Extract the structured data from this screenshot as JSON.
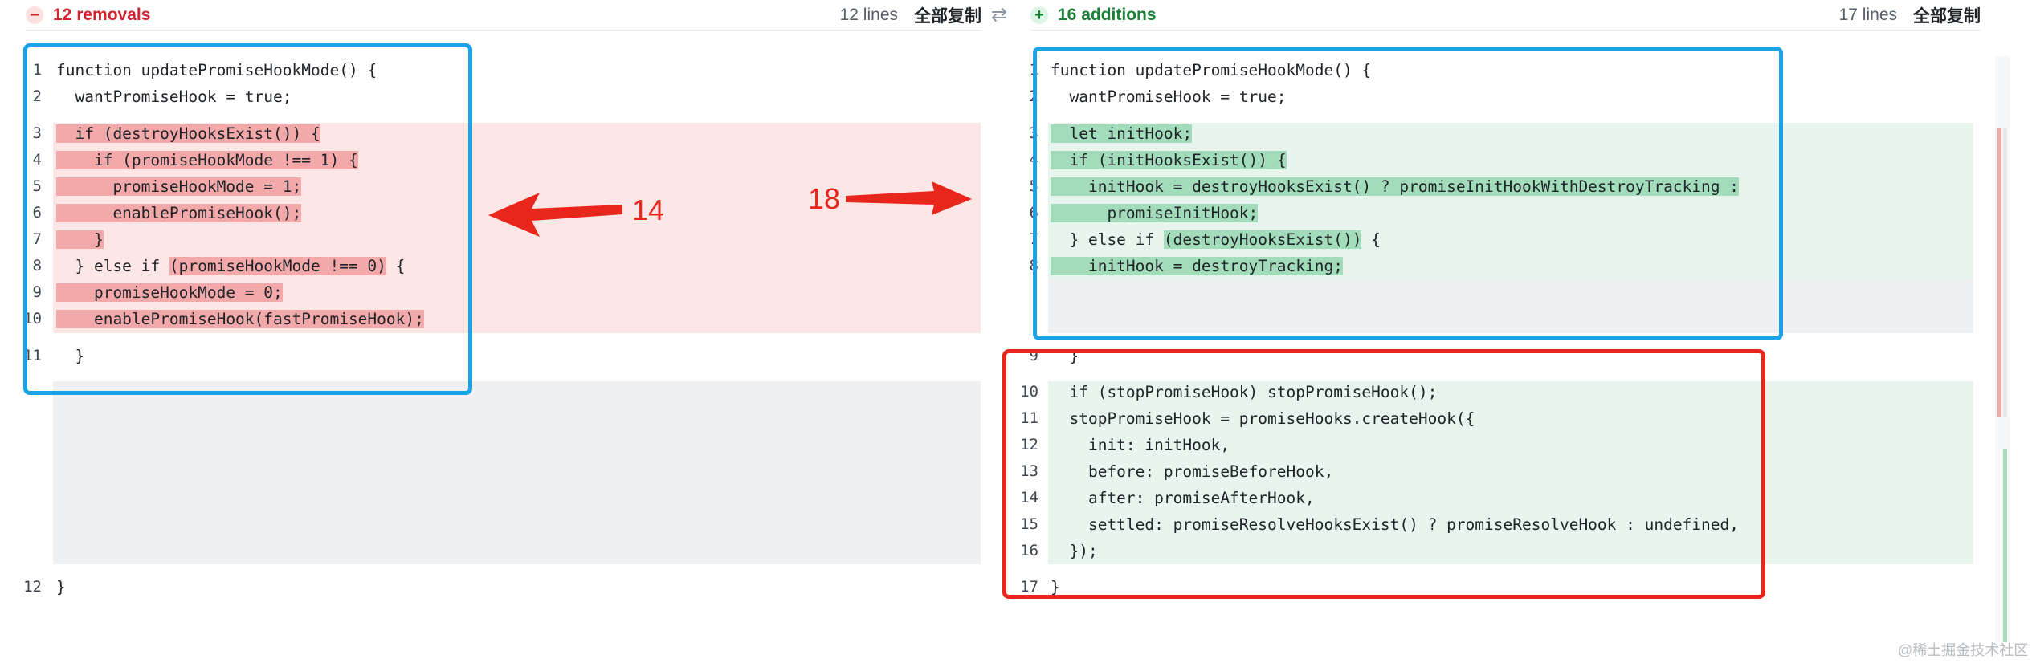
{
  "left_header": {
    "badge_icon": "minus-circle-icon",
    "label": "12 removals",
    "line_count": "12 lines",
    "copy_label": "全部复制"
  },
  "right_header": {
    "badge_icon": "plus-circle-icon",
    "label": "16 additions",
    "line_count": "17 lines",
    "copy_label": "全部复制"
  },
  "swap_icon": "swap-arrows-icon",
  "left_lines": [
    {
      "n": "1",
      "text": "function updatePromiseHookMode() {"
    },
    {
      "n": "2",
      "text": "  wantPromiseHook = true;"
    },
    {
      "n": "3",
      "text": "  if (destroyHooksExist()) {"
    },
    {
      "n": "4",
      "text": "    if (promiseHookMode !== 1) {"
    },
    {
      "n": "5",
      "text": "      promiseHookMode = 1;"
    },
    {
      "n": "6",
      "text": "      enablePromiseHook();"
    },
    {
      "n": "7",
      "text": "    }"
    },
    {
      "n": "8",
      "pre": "  } else if ",
      "hl": "(promiseHookMode !== 0)",
      "post": " {"
    },
    {
      "n": "9",
      "text": "    promiseHookMode = 0;"
    },
    {
      "n": "10",
      "text": "    enablePromiseHook(fastPromiseHook);"
    },
    {
      "n": "11",
      "text": "  }"
    },
    {
      "n": "12",
      "text": "}"
    }
  ],
  "right_lines": [
    {
      "n": "1",
      "text": "function updatePromiseHookMode() {"
    },
    {
      "n": "2",
      "text": "  wantPromiseHook = true;"
    },
    {
      "n": "3",
      "text": "  let initHook;"
    },
    {
      "n": "4",
      "text": "  if (initHooksExist()) {"
    },
    {
      "n": "5",
      "text": "    initHook = destroyHooksExist() ? promiseInitHookWithDestroyTracking :"
    },
    {
      "n": "6",
      "text": "      promiseInitHook;"
    },
    {
      "n": "7",
      "pre": "  } else if ",
      "hl": "(destroyHooksExist())",
      "post": " {"
    },
    {
      "n": "8",
      "text": "    initHook = destroyTracking;"
    },
    {
      "n": "9",
      "text": "  }"
    },
    {
      "n": "10",
      "text": "  if (stopPromiseHook) stopPromiseHook();"
    },
    {
      "n": "11",
      "text": "  stopPromiseHook = promiseHooks.createHook({"
    },
    {
      "n": "12",
      "text": "    init: initHook,"
    },
    {
      "n": "13",
      "text": "    before: promiseBeforeHook,"
    },
    {
      "n": "14",
      "text": "    after: promiseAfterHook,"
    },
    {
      "n": "15",
      "text": "    settled: promiseResolveHooksExist() ? promiseResolveHook : undefined,"
    },
    {
      "n": "16",
      "text": "  });"
    },
    {
      "n": "17",
      "text": "}"
    }
  ],
  "annotations": {
    "left_arrow_label": "14",
    "right_arrow_label": "18"
  },
  "colors": {
    "removed_bg": "#fde6e6",
    "removed_highlight": "#f3a9a9",
    "added_bg": "#e7f5ee",
    "added_highlight": "#a3dcbb",
    "blue_box": "#1aa3e6",
    "red_box": "#e8261b"
  },
  "watermark": "@稀土掘金技术社区"
}
